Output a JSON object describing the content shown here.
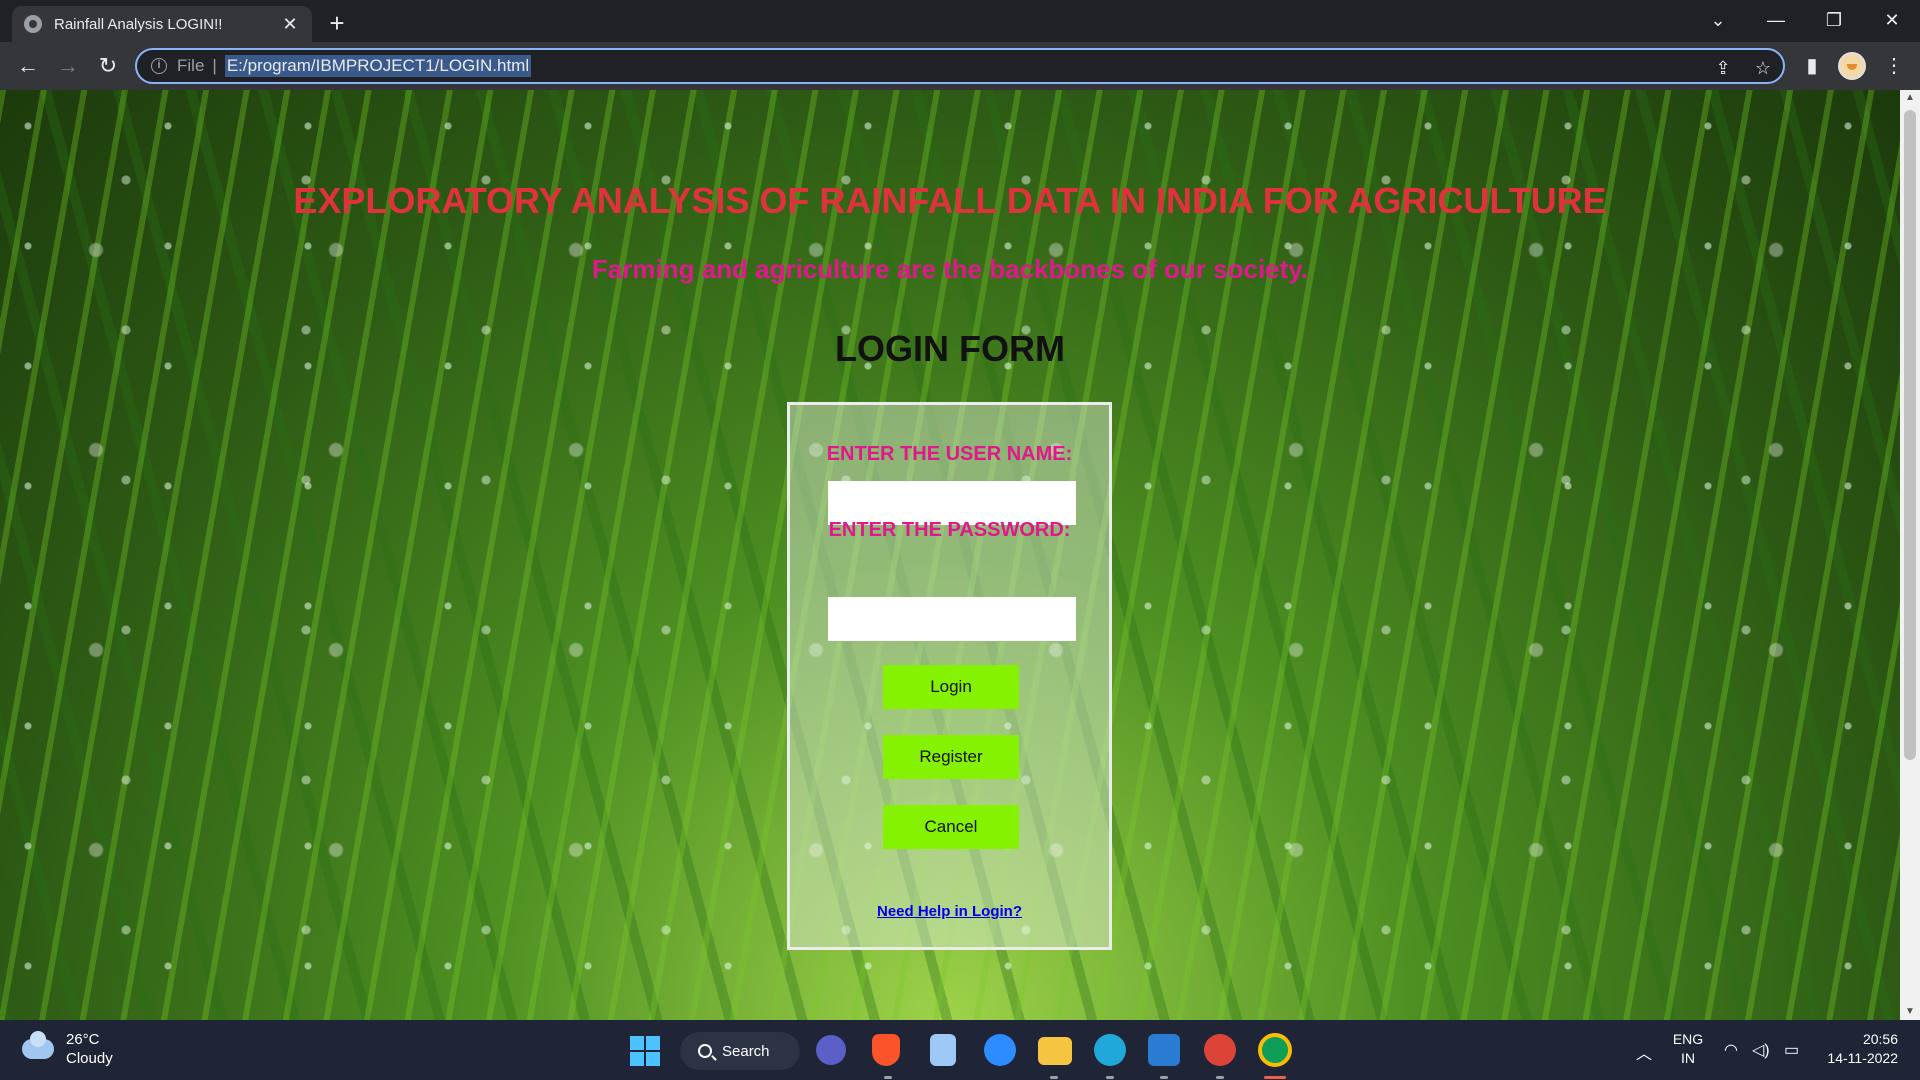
{
  "browser": {
    "tab_title": "Rainfall Analysis LOGIN!!",
    "tab_close": "✕",
    "new_tab": "+",
    "url_scheme": "File",
    "url": "E:/program/IBMPROJECT1/LOGIN.html"
  },
  "page": {
    "title": "EXPLORATORY ANALYSIS OF RAINFALL DATA IN INDIA FOR AGRICULTURE",
    "tagline": "Farming and agriculture are the backbones of our society.",
    "form_heading": "LOGIN FORM",
    "username_label": "ENTER THE USER NAME:",
    "username_value": "",
    "password_label": "ENTER THE PASSWORD:",
    "password_value": "",
    "login_button": "Login",
    "register_button": "Register",
    "cancel_button": "Cancel",
    "help_link": "Need Help in Login?"
  },
  "taskbar": {
    "weather_temp": "26°C",
    "weather_desc": "Cloudy",
    "search_label": "Search",
    "language_top": "ENG",
    "language_bottom": "IN",
    "time": "20:56",
    "date": "14-11-2022"
  },
  "colors": {
    "title": "#e0323c",
    "tagline": "#e0188c",
    "button": "#84f200",
    "link": "#0000ee"
  }
}
